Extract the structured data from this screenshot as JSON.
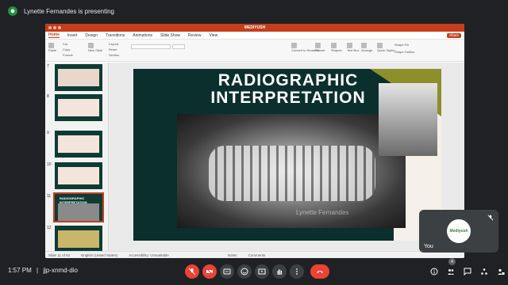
{
  "presenter": {
    "text": "Lynette Fernandes is presenting"
  },
  "ppt": {
    "title": "MEDIYUSH",
    "share_label": "Share",
    "tabs": [
      "Home",
      "Insert",
      "Design",
      "Transitions",
      "Animations",
      "Slide Show",
      "Review",
      "View"
    ],
    "ribbon": {
      "paste": "Paste",
      "cut": "Cut",
      "copy": "Copy",
      "format": "Format",
      "new_slide": "New Slide",
      "layout": "Layout",
      "reset": "Reset",
      "section": "Section",
      "convert": "Convert to SmartArt",
      "picture": "Picture",
      "shapes": "Shapes",
      "textbox": "Text Box",
      "arrange": "Arrange",
      "quick_styles": "Quick Styles",
      "shape_fill": "Shape Fill",
      "shape_outline": "Shape Outline"
    },
    "slides": [
      {
        "num": "7"
      },
      {
        "num": "8"
      },
      {
        "num": "9"
      },
      {
        "num": "10"
      },
      {
        "num": "11",
        "label": "RADIOGRAPHIC INTERPRETATION"
      },
      {
        "num": "12"
      }
    ],
    "slide_title_line1": "RADIOGRAPHIC",
    "slide_title_line2": "INTERPRETATION",
    "watermark": "Lynette Fernandes",
    "status": {
      "slide_of": "Slide 11 of 52",
      "language": "English (United States)",
      "accessibility": "Accessibility: Unavailable",
      "notes": "Notes",
      "comments": "Comments"
    }
  },
  "self": {
    "name": "You",
    "avatar_text": "Mediyush"
  },
  "meeting": {
    "time": "1:57 PM",
    "separator": "|",
    "code": "jjp-xnmd-dio",
    "participants_count": "4"
  },
  "colors": {
    "accent_red": "#ea4335",
    "ppt_red": "#c43e1c",
    "slide_bg": "#0b2f2c"
  }
}
